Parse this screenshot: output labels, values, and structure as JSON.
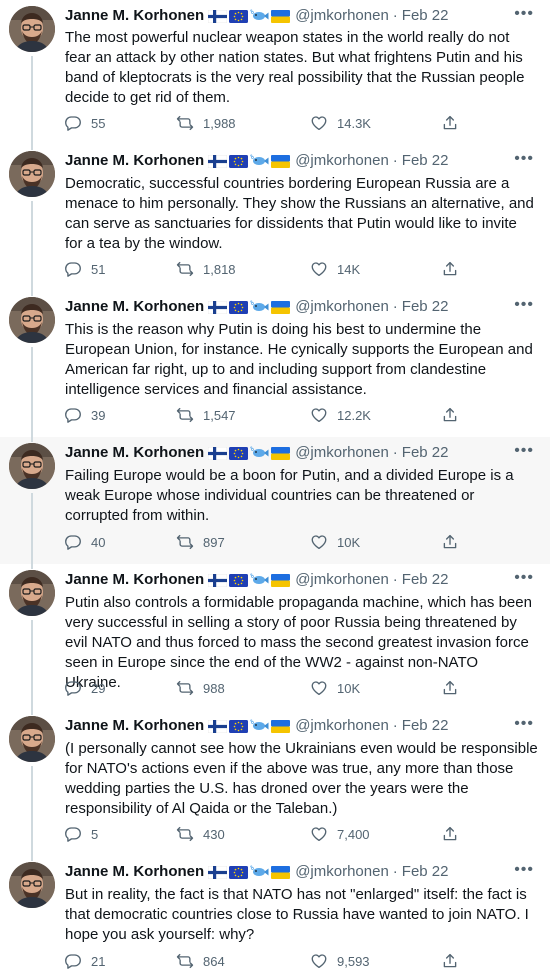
{
  "tweets": [
    {
      "author": "Janne M. Korhonen",
      "handle": "@jmkorhonen",
      "date": "Feb 22",
      "text": "The most powerful nuclear weapon states in the world really do not fear an attack by other nation states. But what frightens Putin and his band of kleptocrats is the very real possibility that the Russian people decide to get rid of them.",
      "replies": "55",
      "retweets": "1,988",
      "likes": "14.3K",
      "highlighted": false
    },
    {
      "author": "Janne M. Korhonen",
      "handle": "@jmkorhonen",
      "date": "Feb 22",
      "text": "Democratic, successful countries bordering European Russia are a menace to him personally. They show the Russians an alternative, and can serve as sanctuaries for dissidents that Putin would like to invite for a tea by the window.",
      "replies": "51",
      "retweets": "1,818",
      "likes": "14K",
      "highlighted": false
    },
    {
      "author": "Janne M. Korhonen",
      "handle": "@jmkorhonen",
      "date": "Feb 22",
      "text": "This is the reason why Putin is doing his best to undermine the European Union, for instance. He cynically supports the European and American far right, up to and including support from clandestine intelligence services and financial assistance.",
      "replies": "39",
      "retweets": "1,547",
      "likes": "12.2K",
      "highlighted": false
    },
    {
      "author": "Janne M. Korhonen",
      "handle": "@jmkorhonen",
      "date": "Feb 22",
      "text": "Failing Europe would be a boon for Putin, and a divided Europe is a weak Europe whose individual countries can be threatened or corrupted from within.",
      "replies": "40",
      "retweets": "897",
      "likes": "10K",
      "highlighted": true
    },
    {
      "author": "Janne M. Korhonen",
      "handle": "@jmkorhonen",
      "date": "Feb 22",
      "text": "Putin also controls a formidable propaganda machine, which has been very successful in selling a story of poor Russia being threatened by evil NATO and thus forced to mass the second greatest invasion force seen in Europe since the end of the WW2 - against non-NATO Ukraine.",
      "replies": "29",
      "retweets": "988",
      "likes": "10K",
      "highlighted": false
    },
    {
      "author": "Janne M. Korhonen",
      "handle": "@jmkorhonen",
      "date": "Feb 22",
      "text": "(I personally cannot see how the Ukrainians even would be responsible for NATO's actions even if the above was true, any more than those wedding parties the U.S. has droned over the years were the responsibility of Al Qaida or the Taleban.)",
      "replies": "5",
      "retweets": "430",
      "likes": "7,400",
      "highlighted": false
    },
    {
      "author": "Janne M. Korhonen",
      "handle": "@jmkorhonen",
      "date": "Feb 22",
      "text": "But in reality, the fact is that NATO has not \"enlarged\" itself: the fact is that democratic countries close to Russia have wanted to join NATO. I hope you ask yourself: why?",
      "replies": "21",
      "retweets": "864",
      "likes": "9,593",
      "highlighted": false
    }
  ],
  "ui": {
    "separator": "·",
    "more_label": "•••",
    "flags": [
      "finland-flag-icon",
      "eu-flag-icon",
      "fish-icon",
      "ukraine-flag-icon"
    ],
    "colors": {
      "text": "#0f1419",
      "secondary": "#536471",
      "rail": "#cfd9de",
      "highlight_bg": "#f7f7f7"
    }
  }
}
